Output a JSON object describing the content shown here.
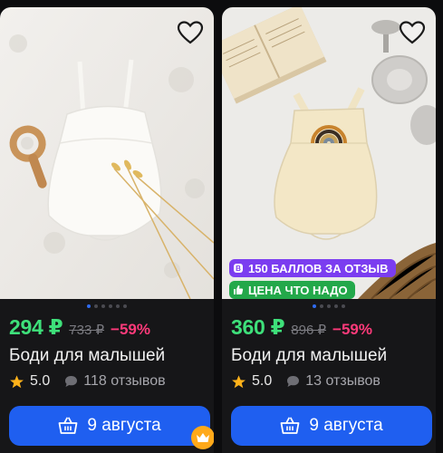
{
  "products": [
    {
      "price": "294 ₽",
      "old_price": "733 ₽",
      "discount": "−59%",
      "title": "Боди для малышей",
      "rating": "5.0",
      "reviews": "118 отзывов",
      "delivery": "9 августа",
      "favorite_icon": "heart-outline-icon"
    },
    {
      "price": "360 ₽",
      "old_price": "896 ₽",
      "discount": "−59%",
      "title": "Боди для малышей",
      "rating": "5.0",
      "reviews": "13 отзывов",
      "delivery": "9 августа",
      "favorite_icon": "heart-outline-icon",
      "badges": [
        "150 БАЛЛОВ ЗА ОТЗЫВ",
        "ЦЕНА ЧТО НАДО"
      ]
    }
  ],
  "colors": {
    "price": "#3ee07a",
    "discount": "#ff3a7a",
    "button": "#1f5ff0",
    "badge_points": "#7b3df0",
    "badge_price": "#23a84a"
  }
}
